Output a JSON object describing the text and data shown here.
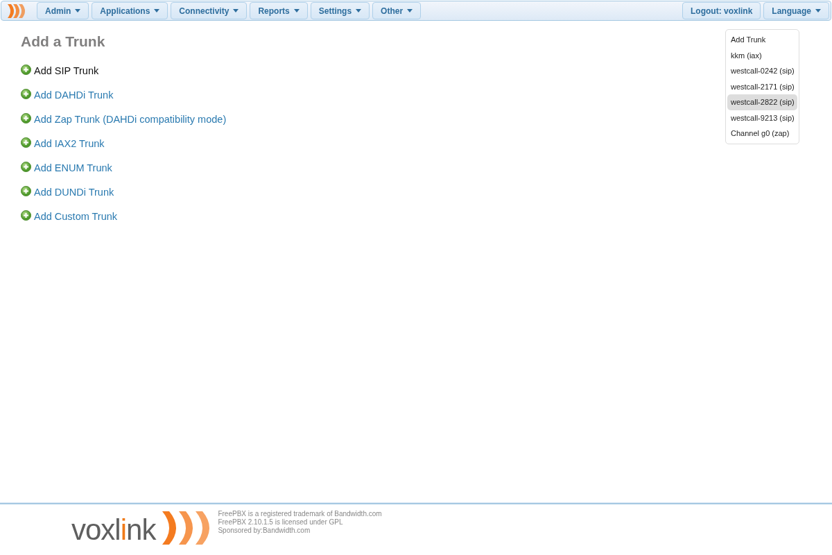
{
  "menu": [
    {
      "label": "Admin"
    },
    {
      "label": "Applications"
    },
    {
      "label": "Connectivity"
    },
    {
      "label": "Reports"
    },
    {
      "label": "Settings"
    },
    {
      "label": "Other"
    }
  ],
  "right_menu": [
    {
      "label": "Logout: voxlink",
      "dropdown": false
    },
    {
      "label": "Language",
      "dropdown": true
    }
  ],
  "page_title": "Add a Trunk",
  "links": [
    {
      "label": "Add SIP Trunk",
      "selected": true
    },
    {
      "label": "Add DAHDi Trunk",
      "selected": false
    },
    {
      "label": "Add Zap Trunk (DAHDi compatibility mode)",
      "selected": false
    },
    {
      "label": "Add IAX2 Trunk",
      "selected": false
    },
    {
      "label": "Add ENUM Trunk",
      "selected": false
    },
    {
      "label": "Add DUNDi Trunk",
      "selected": false
    },
    {
      "label": "Add Custom Trunk",
      "selected": false
    }
  ],
  "sidebar": {
    "items": [
      {
        "label": "Add Trunk",
        "selected": false
      },
      {
        "label": "kkm (iax)",
        "selected": false
      },
      {
        "label": "westcall-0242 (sip)",
        "selected": false
      },
      {
        "label": "westcall-2171 (sip)",
        "selected": false
      },
      {
        "label": "westcall-2822 (sip)",
        "selected": true
      },
      {
        "label": "westcall-9213 (sip)",
        "selected": false
      },
      {
        "label": "Channel g0 (zap)",
        "selected": false
      }
    ]
  },
  "footer": {
    "logo_parts": [
      {
        "text": "voxl",
        "accent": false
      },
      {
        "text": "i",
        "accent": true
      },
      {
        "text": "nk",
        "accent": false
      }
    ],
    "lines": [
      "FreePBX is a registered trademark of Bandwidth.com",
      "FreePBX 2.10.1.5 is licensed under GPL",
      "Sponsored by:Bandwidth.com"
    ]
  }
}
